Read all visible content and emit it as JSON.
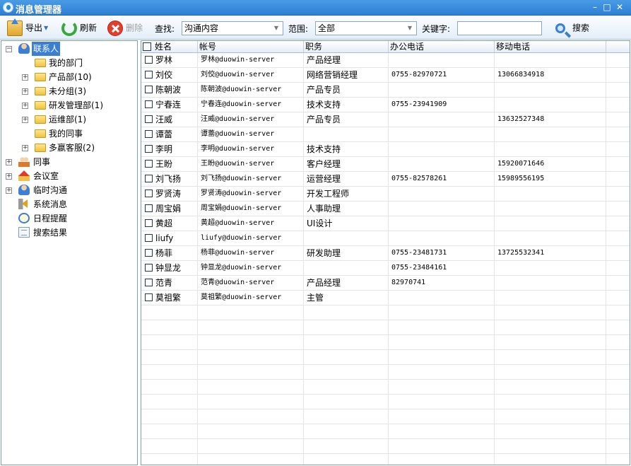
{
  "window": {
    "title": "消息管理器"
  },
  "toolbar": {
    "export_label": "导出",
    "refresh_label": "刷新",
    "delete_label": "删除",
    "find_label": "查找:",
    "find_value": "沟通内容",
    "scope_label": "范围:",
    "scope_value": "全部",
    "keyword_label": "关键字:",
    "keyword_value": "",
    "search_label": "搜索"
  },
  "tree": {
    "root": "联系人",
    "children": [
      "我的部门",
      "产品部(10)",
      "未分组(3)",
      "研发管理部(1)",
      "运维部(1)",
      "我的同事",
      "多嬴客服(2)"
    ],
    "top": [
      "同事",
      "会议室",
      "临时沟通",
      "系统消息",
      "日程提醒",
      "搜索结果"
    ]
  },
  "table": {
    "columns": [
      "姓名",
      "帐号",
      "职务",
      "办公电话",
      "移动电话"
    ],
    "rows": [
      [
        "罗林",
        "罗林@duowin-server",
        "产品经理",
        "",
        ""
      ],
      [
        "刘佼",
        "刘佼@duowin-server",
        "网络营销经理",
        "0755-82970721",
        "13066834918"
      ],
      [
        "陈朝波",
        "陈朝波@duowin-server",
        "产品专员",
        "",
        ""
      ],
      [
        "宁春连",
        "宁春连@duowin-server",
        "技术支持",
        "0755-23941909",
        ""
      ],
      [
        "汪威",
        "汪威@duowin-server",
        "产品专员",
        "",
        "13632527348"
      ],
      [
        "谭蕾",
        "谭蕾@duowin-server",
        "",
        "",
        ""
      ],
      [
        "李明",
        "李明@duowin-server",
        "技术支持",
        "",
        ""
      ],
      [
        "王盼",
        "王盼@duowin-server",
        "客户经理",
        "",
        "15920071646"
      ],
      [
        "刘飞扬",
        "刘飞扬@duowin-server",
        "运营经理",
        "0755-82578261",
        "15989556195"
      ],
      [
        "罗贤涛",
        "罗贤涛@duowin-server",
        "开发工程师",
        "",
        ""
      ],
      [
        "周宝娟",
        "周宝娟@duowin-server",
        "人事助理",
        "",
        ""
      ],
      [
        "黄超",
        "黄超@duowin-server",
        "UI设计",
        "",
        ""
      ],
      [
        "liufy",
        "liufy@duowin-server",
        "",
        "",
        ""
      ],
      [
        "杨菲",
        "杨菲@duowin-server",
        "研发助理",
        "0755-23481731",
        "13725532341"
      ],
      [
        "钟显龙",
        "钟显龙@duowin-server",
        "",
        "0755-23484161",
        ""
      ],
      [
        "范青",
        "范青@duowin-server",
        "产品经理",
        "82970741",
        ""
      ],
      [
        "莫祖繁",
        "莫祖繁@duowin-server",
        "主管",
        "",
        ""
      ]
    ]
  }
}
